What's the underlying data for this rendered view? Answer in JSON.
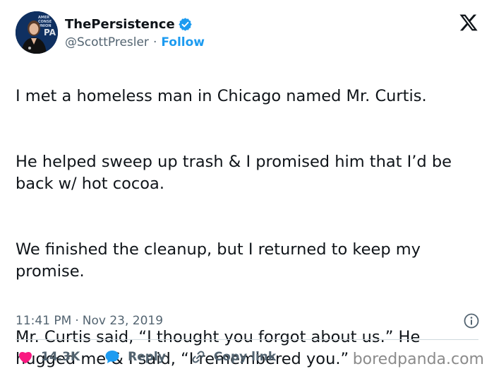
{
  "author": {
    "display_name": "ThePersistence",
    "handle": "@ScottPresler",
    "separator": "·",
    "follow_label": "Follow",
    "avatar_banner_text": "AMER\nCONSE\nUNION",
    "avatar_logo_text": "CPA"
  },
  "tweet": {
    "paragraphs": [
      "I met a homeless man in Chicago named Mr. Curtis.",
      "He helped sweep up trash & I promised him that I’d be back w/ hot cocoa.",
      "We finished the cleanup, but I returned to keep my promise.",
      "Mr. Curtis said, “I thought you forgot about us.” He hugged me & I said, “I remembered you.”"
    ],
    "time": "11:41 PM",
    "date": "Nov 23, 2019",
    "separator": "·"
  },
  "actions": {
    "likes_count": "14.3K",
    "reply_label": "Reply",
    "copy_link_label": "Copy link"
  },
  "watermark": "boredpanda.com",
  "colors": {
    "accent": "#1d9bf0",
    "like": "#f91880",
    "text": "#0f1419",
    "muted": "#536471"
  },
  "icons": {
    "verified": "verified-badge-icon",
    "brand": "x-logo-icon",
    "info": "info-icon",
    "like": "heart-icon",
    "reply": "speech-bubble-icon",
    "copy_link": "link-icon"
  }
}
